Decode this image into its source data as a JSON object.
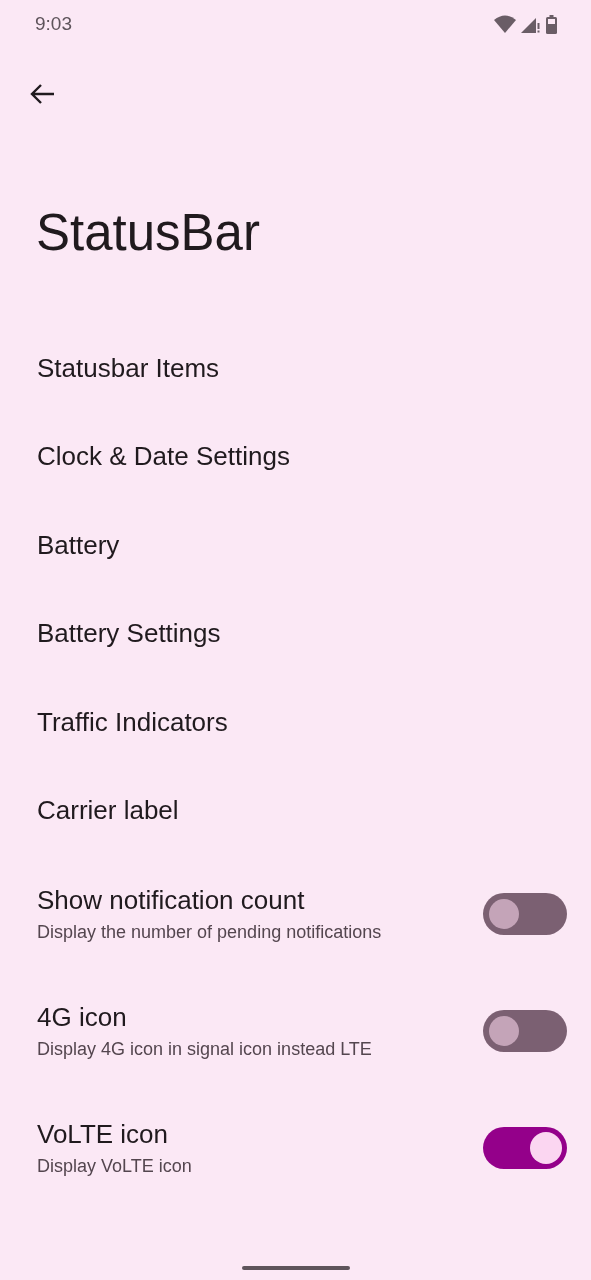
{
  "status_bar": {
    "time": "9:03"
  },
  "title": "StatusBar",
  "items": [
    {
      "kind": "link",
      "title": "Statusbar Items"
    },
    {
      "kind": "link",
      "title": "Clock & Date Settings"
    },
    {
      "kind": "link",
      "title": "Battery"
    },
    {
      "kind": "link",
      "title": "Battery Settings"
    },
    {
      "kind": "link",
      "title": "Traffic Indicators"
    },
    {
      "kind": "link",
      "title": "Carrier label"
    },
    {
      "kind": "switch",
      "title": "Show notification count",
      "summary": "Display the number of pending notifications",
      "on": false
    },
    {
      "kind": "switch",
      "title": "4G icon",
      "summary": "Display 4G icon in signal icon instead LTE",
      "on": false
    },
    {
      "kind": "switch",
      "title": "VoLTE icon",
      "summary": "Display VoLTE icon",
      "on": true
    }
  ]
}
